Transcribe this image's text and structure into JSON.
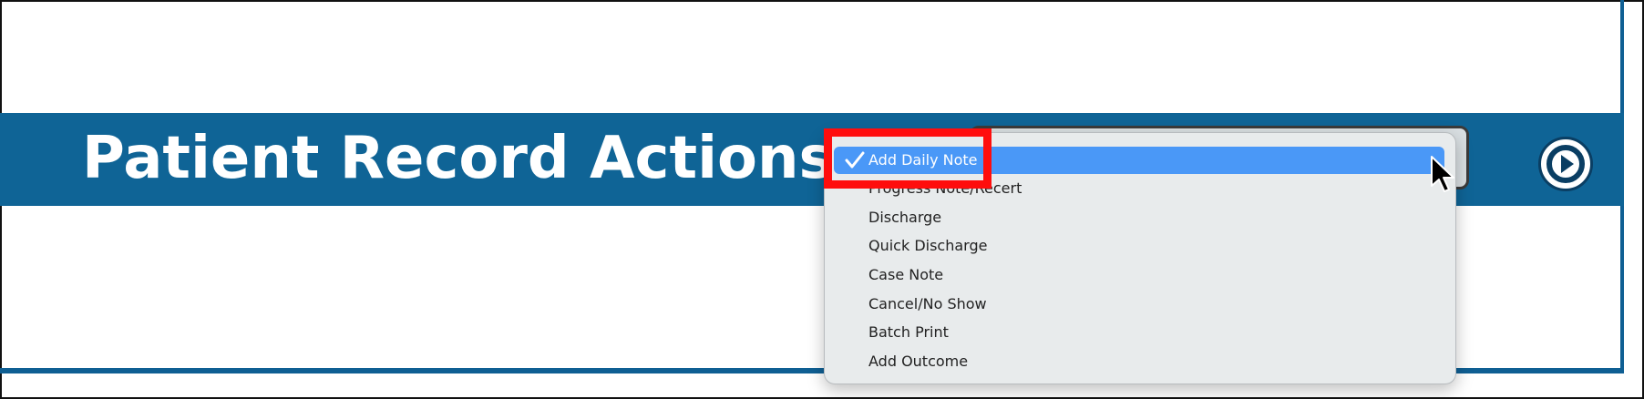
{
  "action_bar": {
    "title": "Patient Record Actions:",
    "color": "#0f6496"
  },
  "dropdown": {
    "selected_index": 0,
    "items": [
      {
        "label": "Add Daily Note"
      },
      {
        "label": "Progress Note/Recert"
      },
      {
        "label": "Discharge"
      },
      {
        "label": "Quick Discharge"
      },
      {
        "label": "Case Note"
      },
      {
        "label": "Cancel/No Show"
      },
      {
        "label": "Batch Print"
      },
      {
        "label": "Add Outcome"
      }
    ],
    "selected_color": "#4a98f7",
    "checkmark_icon": "checkmark-icon"
  },
  "go_button": {
    "icon": "play-circle-icon"
  },
  "annotation": {
    "highlight_color": "#ff0d0d"
  },
  "cursor": {
    "icon": "mouse-pointer-icon"
  }
}
